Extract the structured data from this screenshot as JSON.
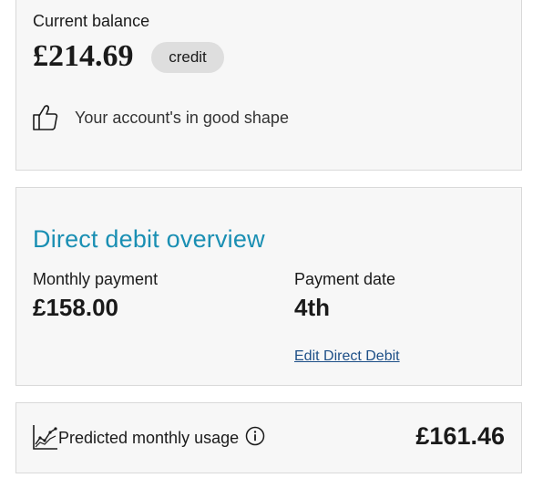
{
  "balance": {
    "label": "Current balance",
    "amount": "£214.69",
    "badge": "credit",
    "status_icon": "thumbs-up-icon",
    "status_text": "Your account's in good shape"
  },
  "direct_debit": {
    "title": "Direct debit overview",
    "monthly_payment_label": "Monthly payment",
    "monthly_payment_value": "£158.00",
    "payment_date_label": "Payment date",
    "payment_date_value": "4th",
    "edit_link": "Edit Direct Debit"
  },
  "usage": {
    "icon": "line-chart-icon",
    "label": "Predicted monthly usage",
    "info_icon": "info-icon",
    "amount": "£161.46"
  },
  "colors": {
    "card_background": "#f7f7f7",
    "card_border": "#d9d9d9",
    "title_accent": "#1a8fb3",
    "link": "#1d4f87",
    "badge_background": "#dedede"
  }
}
